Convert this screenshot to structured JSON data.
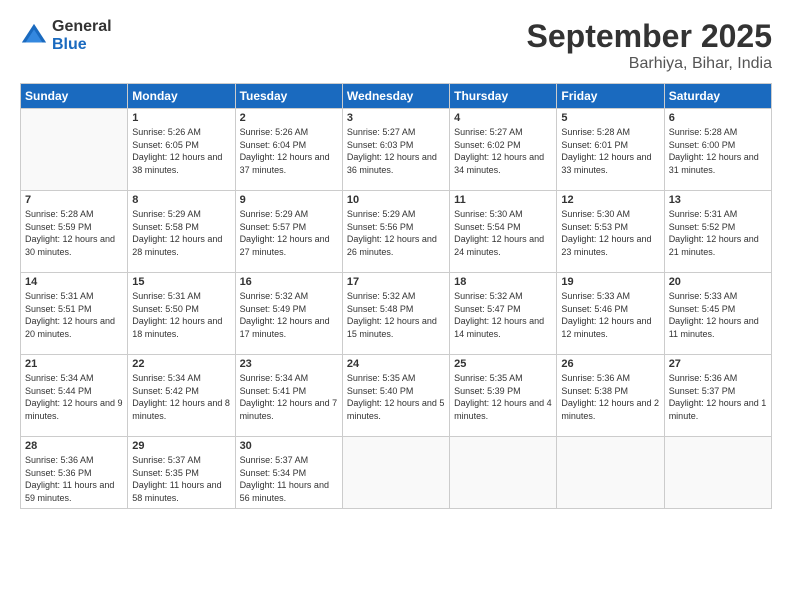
{
  "logo": {
    "general": "General",
    "blue": "Blue"
  },
  "header": {
    "month": "September 2025",
    "location": "Barhiya, Bihar, India"
  },
  "weekdays": [
    "Sunday",
    "Monday",
    "Tuesday",
    "Wednesday",
    "Thursday",
    "Friday",
    "Saturday"
  ],
  "weeks": [
    [
      {
        "day": "",
        "empty": true
      },
      {
        "day": "1",
        "sunrise": "5:26 AM",
        "sunset": "6:05 PM",
        "daylight": "12 hours and 38 minutes."
      },
      {
        "day": "2",
        "sunrise": "5:26 AM",
        "sunset": "6:04 PM",
        "daylight": "12 hours and 37 minutes."
      },
      {
        "day": "3",
        "sunrise": "5:27 AM",
        "sunset": "6:03 PM",
        "daylight": "12 hours and 36 minutes."
      },
      {
        "day": "4",
        "sunrise": "5:27 AM",
        "sunset": "6:02 PM",
        "daylight": "12 hours and 34 minutes."
      },
      {
        "day": "5",
        "sunrise": "5:28 AM",
        "sunset": "6:01 PM",
        "daylight": "12 hours and 33 minutes."
      },
      {
        "day": "6",
        "sunrise": "5:28 AM",
        "sunset": "6:00 PM",
        "daylight": "12 hours and 31 minutes."
      }
    ],
    [
      {
        "day": "7",
        "sunrise": "5:28 AM",
        "sunset": "5:59 PM",
        "daylight": "12 hours and 30 minutes."
      },
      {
        "day": "8",
        "sunrise": "5:29 AM",
        "sunset": "5:58 PM",
        "daylight": "12 hours and 28 minutes."
      },
      {
        "day": "9",
        "sunrise": "5:29 AM",
        "sunset": "5:57 PM",
        "daylight": "12 hours and 27 minutes."
      },
      {
        "day": "10",
        "sunrise": "5:29 AM",
        "sunset": "5:56 PM",
        "daylight": "12 hours and 26 minutes."
      },
      {
        "day": "11",
        "sunrise": "5:30 AM",
        "sunset": "5:54 PM",
        "daylight": "12 hours and 24 minutes."
      },
      {
        "day": "12",
        "sunrise": "5:30 AM",
        "sunset": "5:53 PM",
        "daylight": "12 hours and 23 minutes."
      },
      {
        "day": "13",
        "sunrise": "5:31 AM",
        "sunset": "5:52 PM",
        "daylight": "12 hours and 21 minutes."
      }
    ],
    [
      {
        "day": "14",
        "sunrise": "5:31 AM",
        "sunset": "5:51 PM",
        "daylight": "12 hours and 20 minutes."
      },
      {
        "day": "15",
        "sunrise": "5:31 AM",
        "sunset": "5:50 PM",
        "daylight": "12 hours and 18 minutes."
      },
      {
        "day": "16",
        "sunrise": "5:32 AM",
        "sunset": "5:49 PM",
        "daylight": "12 hours and 17 minutes."
      },
      {
        "day": "17",
        "sunrise": "5:32 AM",
        "sunset": "5:48 PM",
        "daylight": "12 hours and 15 minutes."
      },
      {
        "day": "18",
        "sunrise": "5:32 AM",
        "sunset": "5:47 PM",
        "daylight": "12 hours and 14 minutes."
      },
      {
        "day": "19",
        "sunrise": "5:33 AM",
        "sunset": "5:46 PM",
        "daylight": "12 hours and 12 minutes."
      },
      {
        "day": "20",
        "sunrise": "5:33 AM",
        "sunset": "5:45 PM",
        "daylight": "12 hours and 11 minutes."
      }
    ],
    [
      {
        "day": "21",
        "sunrise": "5:34 AM",
        "sunset": "5:44 PM",
        "daylight": "12 hours and 9 minutes."
      },
      {
        "day": "22",
        "sunrise": "5:34 AM",
        "sunset": "5:42 PM",
        "daylight": "12 hours and 8 minutes."
      },
      {
        "day": "23",
        "sunrise": "5:34 AM",
        "sunset": "5:41 PM",
        "daylight": "12 hours and 7 minutes."
      },
      {
        "day": "24",
        "sunrise": "5:35 AM",
        "sunset": "5:40 PM",
        "daylight": "12 hours and 5 minutes."
      },
      {
        "day": "25",
        "sunrise": "5:35 AM",
        "sunset": "5:39 PM",
        "daylight": "12 hours and 4 minutes."
      },
      {
        "day": "26",
        "sunrise": "5:36 AM",
        "sunset": "5:38 PM",
        "daylight": "12 hours and 2 minutes."
      },
      {
        "day": "27",
        "sunrise": "5:36 AM",
        "sunset": "5:37 PM",
        "daylight": "12 hours and 1 minute."
      }
    ],
    [
      {
        "day": "28",
        "sunrise": "5:36 AM",
        "sunset": "5:36 PM",
        "daylight": "11 hours and 59 minutes."
      },
      {
        "day": "29",
        "sunrise": "5:37 AM",
        "sunset": "5:35 PM",
        "daylight": "11 hours and 58 minutes."
      },
      {
        "day": "30",
        "sunrise": "5:37 AM",
        "sunset": "5:34 PM",
        "daylight": "11 hours and 56 minutes."
      },
      {
        "day": "",
        "empty": true
      },
      {
        "day": "",
        "empty": true
      },
      {
        "day": "",
        "empty": true
      },
      {
        "day": "",
        "empty": true
      }
    ]
  ]
}
